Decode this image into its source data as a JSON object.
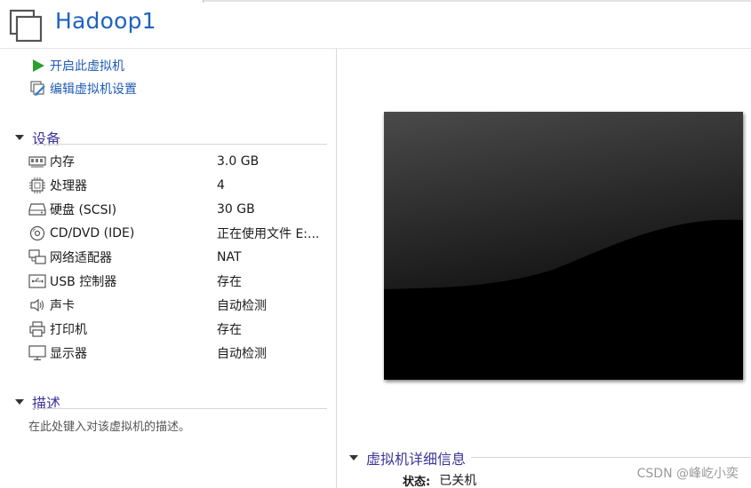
{
  "vm": {
    "name": "Hadoop1"
  },
  "actions": [
    {
      "label": "开启此虚拟机",
      "icon": "play-icon"
    },
    {
      "label": "编辑虚拟机设置",
      "icon": "edit-settings-icon"
    }
  ],
  "devices_section": {
    "title": "设备",
    "items": [
      {
        "name": "内存",
        "value": "3.0 GB",
        "icon": "memory-icon"
      },
      {
        "name": "处理器",
        "value": "4",
        "icon": "cpu-icon"
      },
      {
        "name": "硬盘 (SCSI)",
        "value": "30 GB",
        "icon": "hard-disk-icon"
      },
      {
        "name": "CD/DVD (IDE)",
        "value": "正在使用文件 E:...",
        "icon": "cd-dvd-icon"
      },
      {
        "name": "网络适配器",
        "value": "NAT",
        "icon": "network-icon"
      },
      {
        "name": "USB 控制器",
        "value": "存在",
        "icon": "usb-icon"
      },
      {
        "name": "声卡",
        "value": "自动检测",
        "icon": "speaker-icon"
      },
      {
        "name": "打印机",
        "value": "存在",
        "icon": "printer-icon"
      },
      {
        "name": "显示器",
        "value": "自动检测",
        "icon": "monitor-icon"
      }
    ]
  },
  "description_section": {
    "title": "描述",
    "placeholder": "在此处键入对该虚拟机的描述。"
  },
  "details_section": {
    "title": "虚拟机详细信息",
    "state_label": "状态:",
    "state_value": "已关机"
  },
  "watermark": "CSDN @峰屹小奕",
  "colors": {
    "title_blue": "#1f63c0",
    "link_blue": "#1f5bb5",
    "section_purple": "#3d3599",
    "play_green": "#2e9e2e"
  }
}
